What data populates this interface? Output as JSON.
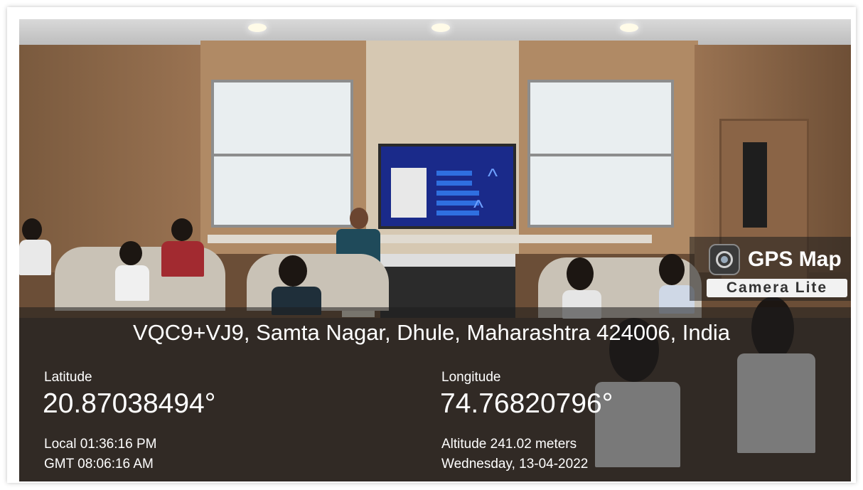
{
  "logo": {
    "title": "GPS Map",
    "subtitle": "Camera Lite",
    "icon": "camera-lens-icon"
  },
  "address": "VQC9+VJ9, Samta Nagar, Dhule, Maharashtra 424006, India",
  "latitude": {
    "label": "Latitude",
    "value": "20.87038494°"
  },
  "longitude": {
    "label": "Longitude",
    "value": "74.76820796°"
  },
  "local_time": "Local 01:36:16 PM",
  "gmt_time": "GMT 08:06:16 AM",
  "altitude": "Altitude 241.02 meters",
  "date": "Wednesday, 13-04-2022",
  "colors": {
    "overlay": "#1e1e1e",
    "text": "#ffffff",
    "wood": "#9a7352"
  }
}
